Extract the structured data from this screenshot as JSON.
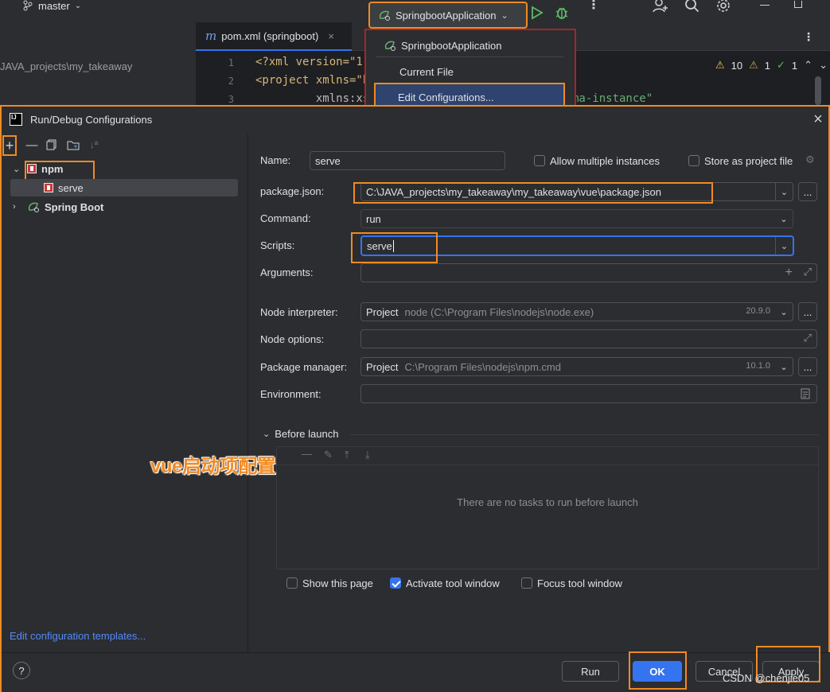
{
  "ide": {
    "branch": "master",
    "project_path": "JAVA_projects\\my_takeaway",
    "file_tab": "pom.xml (springboot)",
    "file_tab_icon": "m",
    "lines": [
      {
        "n": "1",
        "code": "<?xml version=\"1."
      },
      {
        "n": "2",
        "code": "<project xmlns=\"h"
      },
      {
        "n": "3",
        "code": "         xmlns:xs"
      }
    ],
    "code_tail": "ma-instance\"",
    "inspections": {
      "warnings": "10",
      "weak": "1",
      "ok": "1"
    }
  },
  "run_widget": {
    "label": "SpringbootApplication",
    "popup": {
      "items": [
        "SpringbootApplication",
        "Current File",
        "Edit Configurations..."
      ]
    }
  },
  "dialog": {
    "title": "Run/Debug Configurations",
    "tree": {
      "groups": [
        {
          "label": "npm",
          "children": [
            "serve"
          ]
        },
        {
          "label": "Spring Boot",
          "children": []
        }
      ]
    },
    "edit_templates": "Edit configuration templates...",
    "form": {
      "name_label": "Name:",
      "name_value": "serve",
      "allow_multiple": "Allow multiple instances",
      "store_as_project": "Store as project file",
      "package_json_label": "package.json:",
      "package_json_value": "C:\\JAVA_projects\\my_takeaway\\my_takeaway\\vue\\package.json",
      "command_label": "Command:",
      "command_value": "run",
      "scripts_label": "Scripts:",
      "scripts_value": "serve",
      "arguments_label": "Arguments:",
      "node_interp_label": "Node interpreter:",
      "node_interp_prefix": "Project",
      "node_interp_value": "node (C:\\Program Files\\nodejs\\node.exe)",
      "node_interp_version": "20.9.0",
      "node_options_label": "Node options:",
      "pkg_manager_label": "Package manager:",
      "pkg_manager_prefix": "Project",
      "pkg_manager_value": "C:\\Program Files\\nodejs\\npm.cmd",
      "pkg_manager_version": "10.1.0",
      "environment_label": "Environment:",
      "before_launch": "Before launch",
      "no_tasks": "There are no tasks to run before launch",
      "show_this_page": "Show this page",
      "activate_tool_window": "Activate tool window",
      "focus_tool_window": "Focus tool window"
    },
    "buttons": {
      "run": "Run",
      "ok": "OK",
      "cancel": "Cancel",
      "apply": "Apply",
      "help": "?"
    }
  },
  "annotation": "vue启动项配置",
  "watermark": "CSDN @chenjie05",
  "colors": {
    "highlight": "#f08a24",
    "accent": "#3574f0",
    "popup_border": "#a4262c"
  }
}
